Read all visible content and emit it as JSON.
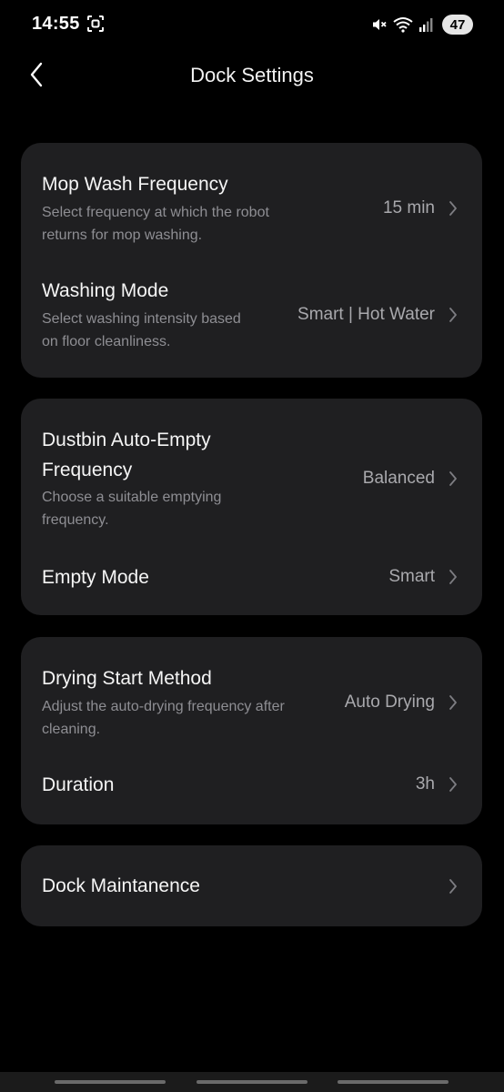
{
  "status_bar": {
    "time": "14:55",
    "battery": "47",
    "icons": [
      "screenshot-icon",
      "mute-icon",
      "wifi-icon",
      "signal-icon"
    ]
  },
  "header": {
    "title": "Dock Settings",
    "back_icon": "chevron-left-icon"
  },
  "cards": {
    "mop": {
      "wash_frequency": {
        "title": "Mop Wash Frequency",
        "description": "Select frequency at which the robot returns for mop washing.",
        "value": "15 min"
      },
      "washing_mode": {
        "title": "Washing Mode",
        "description": "Select washing intensity based on floor cleanliness.",
        "value": "Smart | Hot Water"
      }
    },
    "dustbin": {
      "auto_empty": {
        "title": "Dustbin Auto-Empty Frequency",
        "description": "Choose a suitable emptying frequency.",
        "value": "Balanced"
      },
      "empty_mode": {
        "title": "Empty Mode",
        "value": "Smart"
      }
    },
    "drying": {
      "start_method": {
        "title": "Drying Start Method",
        "description": "Adjust the auto-drying frequency after cleaning.",
        "value": "Auto Drying"
      },
      "duration": {
        "title": "Duration",
        "value": "3h"
      }
    },
    "maintenance": {
      "title": "Dock Maintanence"
    }
  },
  "colors": {
    "background": "#000000",
    "card": "#1f1f21",
    "primary_text": "#f5f5f5",
    "secondary_text": "#8e8e93",
    "value_text": "#a9a9ad"
  }
}
